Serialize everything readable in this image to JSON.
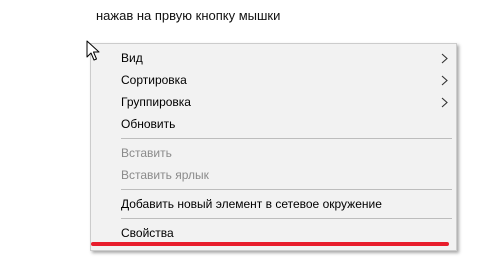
{
  "caption": "нажав на првую кнопку мышки",
  "context_menu": {
    "items": [
      {
        "label": "Вид",
        "enabled": true,
        "submenu": true
      },
      {
        "label": "Сортировка",
        "enabled": true,
        "submenu": true
      },
      {
        "label": "Группировка",
        "enabled": true,
        "submenu": true
      },
      {
        "label": "Обновить",
        "enabled": true,
        "submenu": false
      },
      {
        "label": "Вставить",
        "enabled": false,
        "submenu": false
      },
      {
        "label": "Вставить ярлык",
        "enabled": false,
        "submenu": false
      },
      {
        "label": "Добавить новый элемент в сетевое окружение",
        "enabled": true,
        "submenu": false
      },
      {
        "label": "Свойства",
        "enabled": true,
        "submenu": false,
        "highlighted_with": "red-underline"
      }
    ]
  },
  "colors": {
    "menu_background": "#f2f2f2",
    "disabled_text": "#8a8a8a",
    "highlight_underline": "#e81d2c"
  },
  "icons": [
    "mouse-cursor-icon",
    "chevron-right-icon"
  ]
}
